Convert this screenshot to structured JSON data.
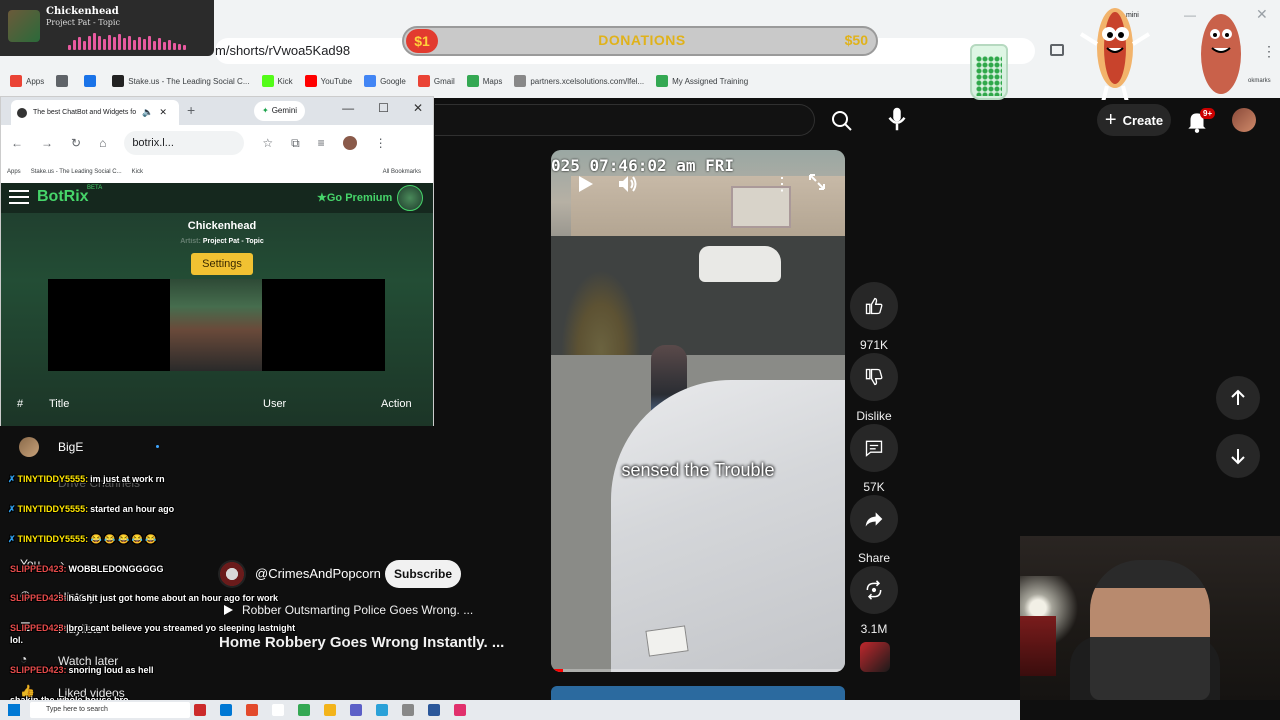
{
  "main_browser": {
    "url_fragment": "m/shorts/rVwoa5Kad98",
    "bookmarks": [
      {
        "label": "Apps",
        "color": "#ea4335"
      },
      {
        "label": "",
        "color": "#5f6368"
      },
      {
        "label": "",
        "color": "#1a73e8"
      },
      {
        "label": "Stake.us - The Leading Social C...",
        "color": "#222222"
      },
      {
        "label": "Kick",
        "color": "#53fc18"
      },
      {
        "label": "YouTube",
        "color": "#ff0000"
      },
      {
        "label": "Google",
        "color": "#4285f4"
      },
      {
        "label": "Gmail",
        "color": "#ea4335"
      },
      {
        "label": "Maps",
        "color": "#34a853"
      },
      {
        "label": "partners.xcelsolutions.com/lfel...",
        "color": "#888888"
      },
      {
        "label": "My Assigned Training",
        "color": "#34a853"
      }
    ],
    "gemini_fragment": "mini",
    "all_bookmarks_fragment": "okmarks"
  },
  "now_playing": {
    "title": "Chickenhead",
    "artist": "Project Pat - Topic",
    "bar_levels": [
      0.3,
      0.55,
      0.7,
      0.5,
      0.8,
      0.95,
      0.75,
      0.6,
      0.85,
      0.7,
      0.9,
      0.65,
      0.8,
      0.55,
      0.7,
      0.6,
      0.75,
      0.5,
      0.65,
      0.45,
      0.55,
      0.4,
      0.35,
      0.3
    ]
  },
  "donations": {
    "start": "$1",
    "label": "DONATIONS",
    "end": "$50"
  },
  "youtube": {
    "create_label": "Create",
    "notification_badge": "9+",
    "video": {
      "timestamp_text": "025 07:46:02 am FRI",
      "caption": "sensed the Trouble",
      "progress": 0.04
    },
    "actions": {
      "likes": "971K",
      "dislike_label": "Dislike",
      "comments": "57K",
      "share_label": "Share",
      "remix_count": "3.1M"
    },
    "channel_name": "@CrimesAndPopcorn",
    "subscribe_label": "Subscribe",
    "related_title": "Robber Outsmarting Police Goes Wrong. ...",
    "video_title": "Home Robbery Goes Wrong Instantly. ..."
  },
  "sidebar": {
    "subscription_name": "BigE",
    "items": {
      "you": "You",
      "history": "History",
      "playlists": "Playlists",
      "watch_later": "Watch later",
      "liked": "Liked videos"
    },
    "behind_chat_label": "Drive Channels"
  },
  "botrix_window": {
    "tab_title": "The best ChatBot and Widgets fo",
    "gemini_label": "Gemini",
    "url": "botrix.l...",
    "bookmarks": [
      "Apps",
      "Stake.us - The Leading Social C...",
      "Kick"
    ],
    "all_bookmarks": "All Bookmarks",
    "logo": "BotRix",
    "beta": "BETA",
    "go_premium": "Go Premium",
    "song_title": "Chickenhead",
    "song_artist_prefix": "Artist:",
    "song_artist": "Project Pat - Topic",
    "settings_label": "Settings",
    "table_headers": {
      "num": "#",
      "title": "Title",
      "user": "User",
      "action": "Action"
    }
  },
  "chat": [
    {
      "user": "TINYTIDDY5555:",
      "user_color": "u1",
      "message": "im just at work rn",
      "emotes": ""
    },
    {
      "user": "TINYTIDDY5555:",
      "user_color": "u1",
      "message": "started an hour ago",
      "emotes": ""
    },
    {
      "user": "TINYTIDDY5555:",
      "user_color": "u1",
      "message": "",
      "emotes": "😂 😂 😂 😂 😂"
    },
    {
      "user": "SLIPPED423:",
      "user_color": "u2",
      "message": "WOBBLEDONGGGGG",
      "emotes": ""
    },
    {
      "user": "SLIPPED423:",
      "user_color": "u2",
      "message": "ha shit just got home about an hour ago for work",
      "emotes": ""
    },
    {
      "user": "SLIPPED423:",
      "user_color": "u2",
      "message": "bro i cant believe you streamed yo sleeping lastnight",
      "emotes": ""
    },
    {
      "user": "",
      "user_color": "u2",
      "message": "lol.",
      "emotes": ""
    },
    {
      "user": "SLIPPED423:",
      "user_color": "u2",
      "message": "snoring loud as hell",
      "emotes": ""
    },
    {
      "user": "",
      "user_color": "u2",
      "message": "shakin the whole house bro",
      "emotes": ""
    }
  ],
  "taskbar": {
    "search_placeholder": "Type here to search",
    "icon_colors": [
      "#cc2a2a",
      "#0078d4",
      "#e34a2c",
      "#ffffff",
      "#34a853",
      "#f3b41b",
      "#5b5fc7",
      "#2aa1d8",
      "#888888",
      "#2b579a",
      "#e1306c"
    ]
  }
}
